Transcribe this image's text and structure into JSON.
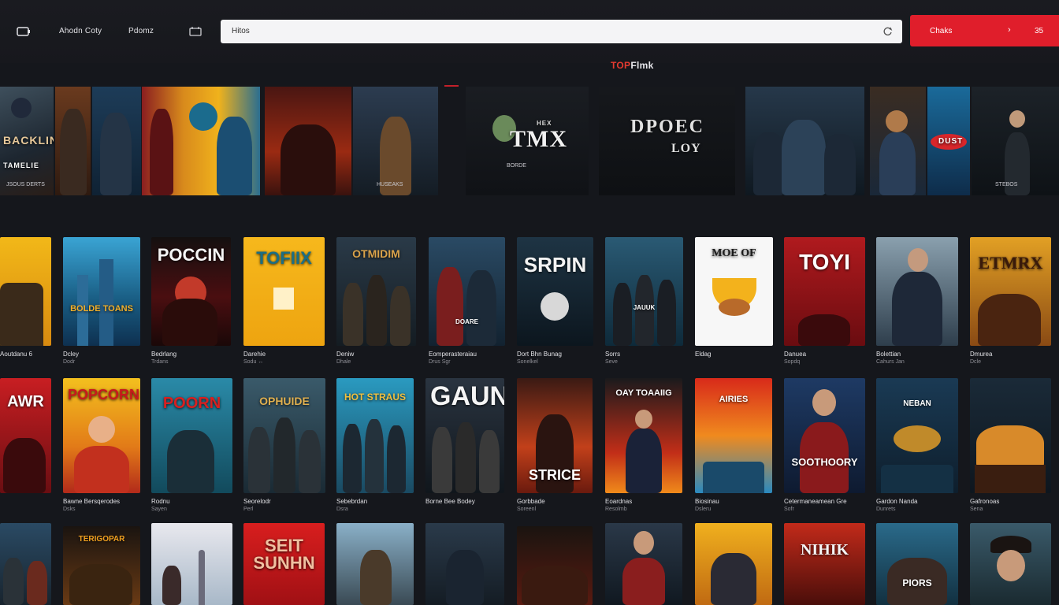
{
  "nav": {
    "primary_label": "Ahodn Coty",
    "secondary_label": "Pdomz"
  },
  "search": {
    "value": "Hitos"
  },
  "cta": {
    "label": "Chaks",
    "count": "35"
  },
  "brand": {
    "part1": "TOP",
    "part2": "Flmk"
  },
  "banner": {
    "posters": [
      {
        "title": "BACKLIN",
        "subtitle": "TAMELIE",
        "caption": "JSOUS DERTS"
      },
      {
        "title": "",
        "subtitle": "",
        "caption": ""
      },
      {
        "title": "",
        "subtitle": "",
        "caption": ""
      },
      {
        "title": "",
        "subtitle": "",
        "caption": ""
      },
      {
        "title": "",
        "subtitle": "",
        "caption": ""
      },
      {
        "title": "",
        "subtitle": "",
        "caption": ""
      },
      {
        "title": "",
        "subtitle": "",
        "caption": "HUSEAKS"
      },
      {
        "title": "TMX",
        "subtitle": "HEX",
        "caption": "BORDE"
      },
      {
        "title": "DPOEC",
        "subtitle": "LOY",
        "caption": ""
      },
      {
        "title": "",
        "subtitle": "",
        "caption": ""
      },
      {
        "title": "",
        "subtitle": "",
        "caption": ""
      },
      {
        "title": "DUST",
        "subtitle": "",
        "caption": ""
      },
      {
        "title": "",
        "subtitle": "",
        "caption": "STEBOS"
      }
    ]
  },
  "rows": [
    [
      {
        "title": "",
        "meta1": "Aoutdanu 6",
        "meta2": ""
      },
      {
        "title": "BOLDE TOANS",
        "meta1": "Dcley",
        "meta2": "Dodr"
      },
      {
        "title": "POCCIN",
        "meta1": "Bedrlang",
        "meta2": "Trdans"
      },
      {
        "title": "TOFIIX",
        "meta1": "Darehie",
        "meta2": "Sodu ↔"
      },
      {
        "title": "OTMIDIM",
        "meta1": "Deniw",
        "meta2": "Dhale"
      },
      {
        "title": "DOARE",
        "meta1": "Eomperasteraiau",
        "meta2": "Drus Sgr"
      },
      {
        "title": "SRPIN",
        "meta1": "Dort Bhn Bunag",
        "meta2": "Sonelkel"
      },
      {
        "title": "JAUUK",
        "meta1": "Sorrs",
        "meta2": "Seve"
      },
      {
        "title": "MOE OF",
        "meta1": "Eldag",
        "meta2": ""
      },
      {
        "title": "TOYI",
        "meta1": "Danuea",
        "meta2": "Sopdq"
      },
      {
        "title": "",
        "meta1": "Bolettian",
        "meta2": "Cahurs Jan"
      },
      {
        "title": "ETMRX",
        "meta1": "Dmurea",
        "meta2": "Dcle"
      }
    ],
    [
      {
        "title": "AWR",
        "meta1": "",
        "meta2": ""
      },
      {
        "title": "POPCORN",
        "meta1": "Bawne Bersqerodes",
        "meta2": "Dsks"
      },
      {
        "title": "POORN",
        "meta1": "Rodnu",
        "meta2": "Sayen"
      },
      {
        "title": "OPHUIDE",
        "meta1": "Seorelodr",
        "meta2": "Perl"
      },
      {
        "title": "HOT STRAUS",
        "meta1": "Sebebrdan",
        "meta2": "Dsra"
      },
      {
        "title": "GAUN",
        "meta1": "Borne Bee Bodey",
        "meta2": ""
      },
      {
        "title": "STRICE",
        "meta1": "Gorbbade",
        "meta2": "Soreenl"
      },
      {
        "title": "OAY TOAAIIG",
        "meta1": "Eoardnas",
        "meta2": "Resolmb"
      },
      {
        "title": "AIRIES",
        "meta1": "Biosinau",
        "meta2": "Dsleru"
      },
      {
        "title": "SOOTHOORY",
        "meta1": "Cetermaneamean Gre",
        "meta2": "Sofr"
      },
      {
        "title": "NEBAN",
        "meta1": "Gardon Nanda",
        "meta2": "Dunrets"
      },
      {
        "title": "",
        "meta1": "Gafronoas",
        "meta2": "Sena"
      }
    ],
    [
      {
        "title": "",
        "meta1": "",
        "meta2": ""
      },
      {
        "title": "TERIGOPAR",
        "meta1": "",
        "meta2": ""
      },
      {
        "title": "",
        "meta1": "",
        "meta2": ""
      },
      {
        "title": "SEIT SUNHN",
        "meta1": "",
        "meta2": ""
      },
      {
        "title": "",
        "meta1": "",
        "meta2": ""
      },
      {
        "title": "",
        "meta1": "",
        "meta2": ""
      },
      {
        "title": "",
        "meta1": "",
        "meta2": ""
      },
      {
        "title": "",
        "meta1": "",
        "meta2": ""
      },
      {
        "title": "",
        "meta1": "",
        "meta2": ""
      },
      {
        "title": "NIHIK",
        "meta1": "",
        "meta2": ""
      },
      {
        "title": "PIORS",
        "meta1": "",
        "meta2": ""
      },
      {
        "title": "",
        "meta1": "",
        "meta2": ""
      }
    ]
  ]
}
